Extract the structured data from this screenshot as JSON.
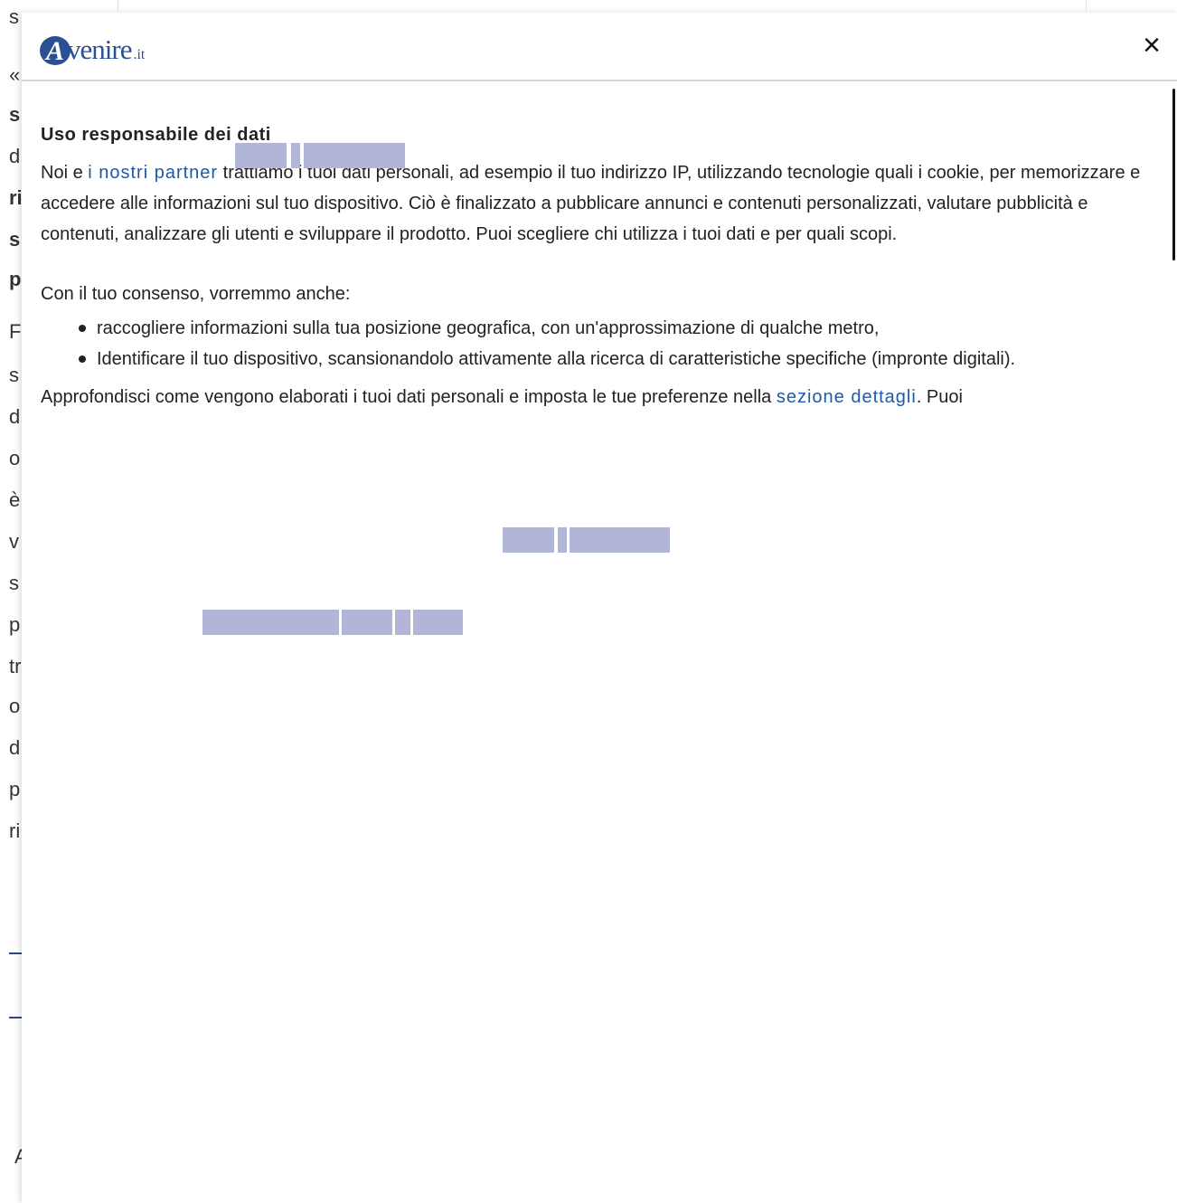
{
  "background": {
    "lines": [
      {
        "text": "s",
        "bold": false
      },
      {
        "text": "«",
        "bold": false
      },
      {
        "text": "s",
        "bold": true
      },
      {
        "text": "d",
        "bold": false
      },
      {
        "text": "ri",
        "bold": true
      },
      {
        "text": "s",
        "bold": true
      },
      {
        "text": "p",
        "bold": true
      },
      {
        "text": "F",
        "bold": false
      },
      {
        "text": "s",
        "bold": false
      },
      {
        "text": "d",
        "bold": false
      },
      {
        "text": "o",
        "bold": false
      },
      {
        "text": "è",
        "bold": false
      },
      {
        "text": "v",
        "bold": false
      },
      {
        "text": "s",
        "bold": false
      },
      {
        "text": "p",
        "bold": false
      },
      {
        "text": "tr",
        "bold": false
      },
      {
        "text": "o",
        "bold": false
      },
      {
        "text": "d",
        "bold": false
      },
      {
        "text": "p",
        "bold": false
      },
      {
        "text": "ri",
        "bold": false
      }
    ],
    "bottom_letter": "A"
  },
  "modal": {
    "logo": {
      "initial": "A",
      "name": "venire",
      "suffix": ".it"
    },
    "close_symbol": "×",
    "title": "Uso responsabile dei dati",
    "intro": {
      "before_link": "Noi e ",
      "link": "i nostri partner",
      "after_link": " trattiamo i tuoi dati personali, ad esempio il tuo indirizzo IP, utilizzando tecnologie quali i cookie, per memorizzare e accedere alle informazioni sul tuo dispositivo. Ciò è finalizzato a pubblicare annunci e contenuti personalizzati, valutare pubblicità e contenuti, analizzare gli utenti e sviluppare il prodotto. Puoi scegliere chi utilizza i tuoi dati e per quali scopi."
    },
    "consent_intro": "Con il tuo consenso, vorremmo anche:",
    "bullets": [
      "raccogliere informazioni sulla tua posizione geografica, con un'approssimazione di qualche metro,",
      "Identificare il tuo dispositivo, scansionandolo attivamente alla ricerca di caratteristiche specifiche (impronte digitali)."
    ],
    "details": {
      "before_link": "Approfondisci come vengono elaborati i tuoi dati personali e imposta le tue preferenze nella ",
      "link": "sezione dettagli",
      "after_link": ". Puoi"
    }
  },
  "colors": {
    "accent": "#1d5aa8",
    "brand": "#2a4f93",
    "placeholder": "#b1b6d8"
  }
}
